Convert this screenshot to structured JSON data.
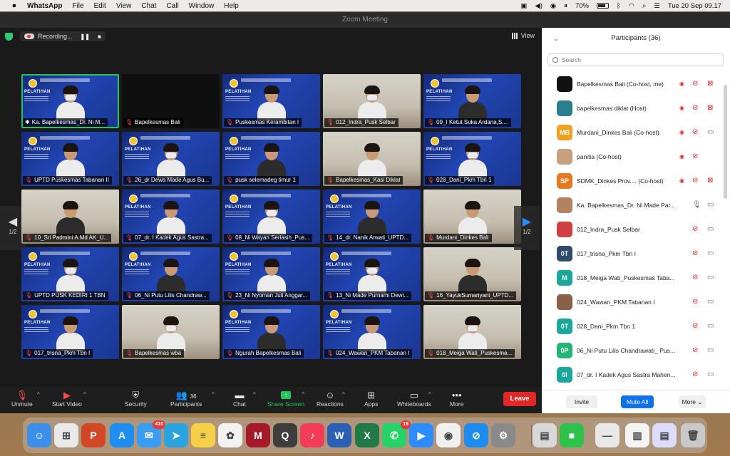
{
  "menubar": {
    "app": "WhatsApp",
    "menus": [
      "File",
      "Edit",
      "View",
      "Chat",
      "Call",
      "Window",
      "Help"
    ],
    "battery": "70%",
    "clock": "Tue 20 Sep  09.17"
  },
  "window": {
    "title": "Zoom Meeting"
  },
  "topbar": {
    "recording": "Recording...",
    "pause": "❚❚",
    "stop": "■",
    "view": "View"
  },
  "gallery": {
    "page_left": "1/2",
    "page_right": "1/2",
    "tiles": [
      {
        "name": "Ka. Bapelkesmas_Dr. Ni M...",
        "bg": "blue",
        "muted": false,
        "active": true
      },
      {
        "name": "Bapelkesmas Bali",
        "bg": "dark",
        "muted": true
      },
      {
        "name": "Puskesmas Kerambitan I",
        "bg": "blue",
        "muted": true
      },
      {
        "name": "012_Indra_Pusk Selbar",
        "bg": "room",
        "muted": true
      },
      {
        "name": "09_I Ketut Suka Ardana,S....",
        "bg": "blue",
        "muted": true
      },
      {
        "name": "UPTD Puskesmas Tabanan II",
        "bg": "blue",
        "muted": true
      },
      {
        "name": "26_dr Dewa Made Agus Bu...",
        "bg": "blue",
        "muted": true
      },
      {
        "name": "pusk selemadeg timur 1",
        "bg": "blue",
        "muted": true
      },
      {
        "name": "Bapelkesmas_Kasi Diklat",
        "bg": "room",
        "muted": true
      },
      {
        "name": "028_Dani_Pkm Tbn 1",
        "bg": "blue",
        "muted": true
      },
      {
        "name": "10_Sri Padmini A.Md AK_U...",
        "bg": "room",
        "muted": true
      },
      {
        "name": "07_dr. I Kadek Agus Sastra...",
        "bg": "blue",
        "muted": true
      },
      {
        "name": "08_Ni Wayan Seriasih_Pus...",
        "bg": "blue",
        "muted": true
      },
      {
        "name": "14_dr. Nanik Arwati_UPTD...",
        "bg": "blue",
        "muted": true
      },
      {
        "name": "Murdani_Dinkes Bali",
        "bg": "room",
        "muted": true
      },
      {
        "name": "UPTD PUSK KEDIRI 1 TBN",
        "bg": "blue",
        "muted": true
      },
      {
        "name": "06_Ni Putu Lilis Chandraw...",
        "bg": "blue",
        "muted": true
      },
      {
        "name": "23_Ni Nyoman Juli Anggar...",
        "bg": "blue",
        "muted": true
      },
      {
        "name": "13_Ni Made Purnami Dewi...",
        "bg": "blue",
        "muted": true
      },
      {
        "name": "16_YayukSumariyani_UPTD...",
        "bg": "room",
        "muted": true
      },
      {
        "name": "017_trisna_Pkm Tbn I",
        "bg": "blue",
        "muted": true
      },
      {
        "name": "Bapelkesmas wba",
        "bg": "room",
        "muted": true
      },
      {
        "name": "Ngurah Bapelkesmas Bali",
        "bg": "blue",
        "muted": true
      },
      {
        "name": "024_Wawan_PKM Tabanan I",
        "bg": "blue",
        "muted": true
      },
      {
        "name": "018_Meiga Wati_Puskesma...",
        "bg": "room",
        "muted": true
      }
    ]
  },
  "toolbar": {
    "unmute": "Unmute",
    "start_video": "Start Video",
    "security": "Security",
    "participants": "Participants",
    "participants_count": "36",
    "chat": "Chat",
    "share_screen": "Share Screen",
    "reactions": "Reactions",
    "apps": "Apps",
    "whiteboards": "Whiteboards",
    "more": "More",
    "leave": "Leave"
  },
  "panel": {
    "title": "Participants (36)",
    "search_placeholder": "Search",
    "participants": [
      {
        "name": "Bapelkesmas Bali (Co-host, me)",
        "avatar": "",
        "color": "#111111",
        "mic": "muted",
        "cam": "off",
        "dot": true
      },
      {
        "name": "bapelkesmas diklat (Host)",
        "avatar": "",
        "color": "#2a7f8f",
        "mic": "muted",
        "cam": "off",
        "dot": true
      },
      {
        "name": "Murdani_Dinkes Bali (Co-host)",
        "avatar": "MB",
        "color": "#f0a020",
        "mic": "muted",
        "cam": "on",
        "dot": true
      },
      {
        "name": "panitia  (Co-host)",
        "avatar": "",
        "color": "#c8a080",
        "mic": "muted",
        "cam": "none",
        "dot": true
      },
      {
        "name": "SDMK_Dinkes Prov....  (Co-host)",
        "avatar": "SP",
        "color": "#e8791e",
        "mic": "muted",
        "cam": "off",
        "dot": true
      },
      {
        "name": "Ka. Bapelkesmas_Dr. Ni Made Par...",
        "avatar": "",
        "color": "#b38260",
        "mic": "on",
        "cam": "on",
        "dot": false
      },
      {
        "name": "012_Indra_Pusk Selbar",
        "avatar": "",
        "color": "#d04040",
        "mic": "muted",
        "cam": "on",
        "dot": false
      },
      {
        "name": "017_trisna_Pkm Tbn I",
        "avatar": "0T",
        "color": "#2f4a6b",
        "mic": "muted",
        "cam": "on",
        "dot": false
      },
      {
        "name": "018_Meiga Wati_Puskesmas Taba...",
        "avatar": "M",
        "color": "#1aa89a",
        "mic": "muted",
        "cam": "on",
        "dot": false
      },
      {
        "name": "024_Wawan_PKM Tabanan I",
        "avatar": "",
        "color": "#8a6048",
        "mic": "muted",
        "cam": "on",
        "dot": false
      },
      {
        "name": "028_Dani_Pkm Tbn 1",
        "avatar": "0T",
        "color": "#1aa89a",
        "mic": "muted",
        "cam": "on",
        "dot": false
      },
      {
        "name": "06_Ni Putu Lilis Chandrawati_ Pus...",
        "avatar": "0P",
        "color": "#22b573",
        "mic": "muted",
        "cam": "on",
        "dot": false
      },
      {
        "name": "07_dr. I Kadek Agus Sastra Mahen...",
        "avatar": "0I",
        "color": "#1aa89a",
        "mic": "muted",
        "cam": "on",
        "dot": false
      }
    ],
    "invite": "Invite",
    "mute_all": "Mute All",
    "more": "More"
  },
  "dock": {
    "apps": [
      {
        "name": "Finder",
        "color": "#3b8fe8",
        "glyph": "☺"
      },
      {
        "name": "Launchpad",
        "color": "#e9e9e9",
        "glyph": "⊞"
      },
      {
        "name": "PowerPoint",
        "color": "#d24726",
        "glyph": "P"
      },
      {
        "name": "App Store",
        "color": "#1e8ef0",
        "glyph": "A"
      },
      {
        "name": "Mail",
        "color": "#3a9cf3",
        "glyph": "✉",
        "badge": "410"
      },
      {
        "name": "Telegram",
        "color": "#2aa3df",
        "glyph": "➤"
      },
      {
        "name": "Notes",
        "color": "#f7d04a",
        "glyph": "≡"
      },
      {
        "name": "Photos",
        "color": "#f2f2f2",
        "glyph": "✿"
      },
      {
        "name": "Mendeley",
        "color": "#a51a2a",
        "glyph": "M"
      },
      {
        "name": "QuickTime",
        "color": "#3d3d3d",
        "glyph": "Q"
      },
      {
        "name": "Music",
        "color": "#f33d58",
        "glyph": "♪"
      },
      {
        "name": "Word",
        "color": "#2b5fb3",
        "glyph": "W"
      },
      {
        "name": "Excel",
        "color": "#1f7a45",
        "glyph": "X"
      },
      {
        "name": "WhatsApp",
        "color": "#25d366",
        "glyph": "✆",
        "badge": "19"
      },
      {
        "name": "Zoom",
        "color": "#2d8cff",
        "glyph": "▶"
      },
      {
        "name": "Chrome",
        "color": "#f0f0f0",
        "glyph": "◉"
      },
      {
        "name": "Safari",
        "color": "#1d8cf0",
        "glyph": "⊘"
      },
      {
        "name": "System Preferences",
        "color": "#8a8a8a",
        "glyph": "⚙"
      },
      {
        "name": "Preview",
        "color": "#d8d8d8",
        "glyph": "▤"
      },
      {
        "name": "FaceTime",
        "color": "#2ec24b",
        "glyph": "■"
      },
      {
        "name": "Window 1",
        "color": "#e8e8e8",
        "glyph": "—"
      },
      {
        "name": "Window 2",
        "color": "#f4f4f4",
        "glyph": "▥"
      },
      {
        "name": "Window 3",
        "color": "#dcdcff",
        "glyph": "▤"
      },
      {
        "name": "Trash",
        "color": "#c9c9c9",
        "glyph": "🗑"
      }
    ]
  }
}
